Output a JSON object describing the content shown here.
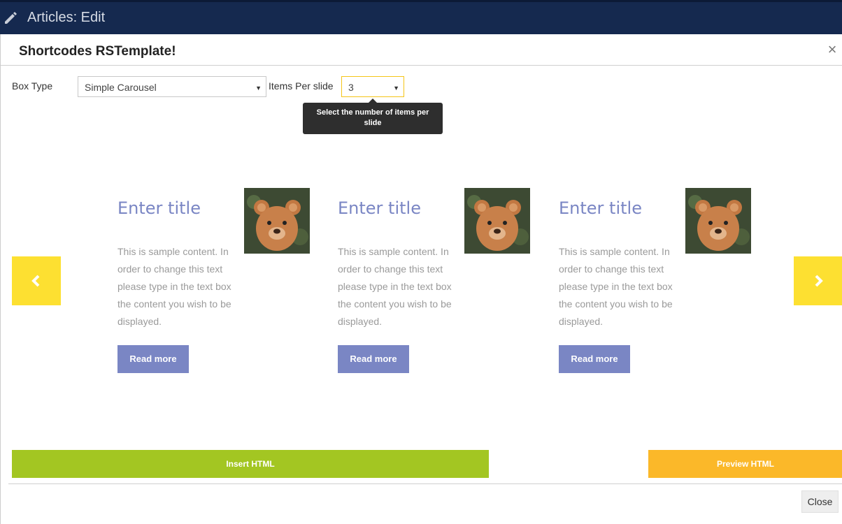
{
  "header": {
    "title": "Articles: Edit",
    "icon": "pencil-icon"
  },
  "modal": {
    "title": "Shortcodes RSTemplate!",
    "close_icon": "×",
    "box_type": {
      "label": "Box Type",
      "value": "Simple Carousel"
    },
    "items_per_slide": {
      "label": "Items Per slide",
      "value": "3"
    },
    "tooltip": "Select the number of items per slide",
    "cards": [
      {
        "title": "Enter title",
        "text": "This is sample content. In order to change this text please type in the text box the content you wish to be displayed.",
        "button": "Read more"
      },
      {
        "title": "Enter title",
        "text": "This is sample content. In order to change this text please type in the text box the content you wish to be displayed.",
        "button": "Read more"
      },
      {
        "title": "Enter title",
        "text": "This is sample content. In order to change this text please type in the text box the content you wish to be displayed.",
        "button": "Read more"
      }
    ],
    "insert_button": "Insert HTML",
    "preview_button": "Preview HTML",
    "close_button": "Close"
  },
  "colors": {
    "topbar": "#15294f",
    "accent_yellow": "#fde031",
    "card_purple": "#7a86c4",
    "insert_green": "#a3c622",
    "preview_orange": "#fbb829"
  }
}
